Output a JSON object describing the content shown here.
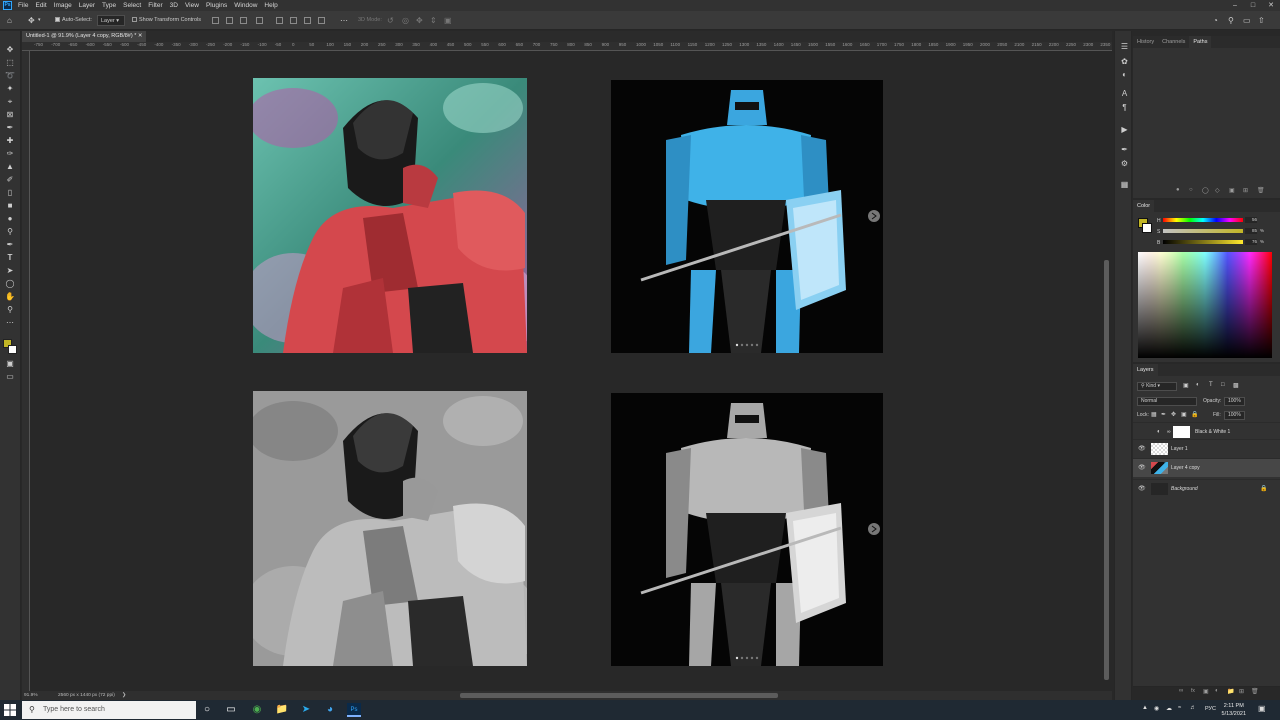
{
  "menubar": {
    "app_icon": "Ps",
    "items": [
      "File",
      "Edit",
      "Image",
      "Layer",
      "Type",
      "Select",
      "Filter",
      "3D",
      "View",
      "Plugins",
      "Window",
      "Help"
    ]
  },
  "options": {
    "auto_select_label": "Auto-Select:",
    "auto_select_value": "Layer",
    "transform_controls_label": "Show Transform Controls",
    "mode_3d_label": "3D Mode:"
  },
  "document": {
    "tab_title": "Untitled-1 @ 91.9% (Layer 4 copy, RGB/8#) *"
  },
  "ruler_labels": [
    "-750",
    "-700",
    "-650",
    "-600",
    "-550",
    "-500",
    "-450",
    "-400",
    "-350",
    "-300",
    "-250",
    "-200",
    "-150",
    "-100",
    "-50",
    "0",
    "50",
    "100",
    "150",
    "200",
    "250",
    "300",
    "350",
    "400",
    "450",
    "500",
    "550",
    "600",
    "650",
    "700",
    "750",
    "800",
    "850",
    "900",
    "950",
    "1000",
    "1050",
    "1100",
    "1150",
    "1200",
    "1250",
    "1300",
    "1350",
    "1400",
    "1450",
    "1500",
    "1550",
    "1600",
    "1650",
    "1700",
    "1750",
    "1800",
    "1850",
    "1900",
    "1950",
    "2000",
    "2050",
    "2100",
    "2150",
    "2200",
    "2250",
    "2300",
    "2350"
  ],
  "status": {
    "zoom": "91.9%",
    "doc_size": "2560 px x 1440 px (72 ppi)"
  },
  "panels": {
    "top_tabs": [
      "History",
      "Channels",
      "Paths"
    ],
    "color_tab": "Color",
    "hsb": [
      {
        "label": "H",
        "value": "56"
      },
      {
        "label": "S",
        "value": "85"
      },
      {
        "label": "B",
        "value": "76"
      }
    ],
    "hsb_unit": "%",
    "foreground_color": "#c2b626",
    "layers_tab": "Layers",
    "kind_label": "Kind",
    "blend_mode": "Normal",
    "opacity_label": "Opacity:",
    "opacity_value": "100%",
    "lock_label": "Lock:",
    "fill_label": "Fill:",
    "fill_value": "100%",
    "layers": [
      {
        "name": "Black & White 1",
        "visible": false,
        "type": "adjustment"
      },
      {
        "name": "Layer 1",
        "visible": true,
        "type": "transparent"
      },
      {
        "name": "Layer 4 copy",
        "visible": true,
        "type": "image",
        "selected": true
      },
      {
        "name": "Background",
        "visible": true,
        "type": "background",
        "locked": true
      }
    ]
  },
  "taskbar": {
    "search_placeholder": "Type here to search",
    "lang": "РУС",
    "time": "2:11 PM",
    "date": "5/13/2021"
  },
  "colors": {
    "accent_blue": "#31a8ff",
    "panel_bg": "#323232",
    "canvas_bg": "#282828"
  }
}
